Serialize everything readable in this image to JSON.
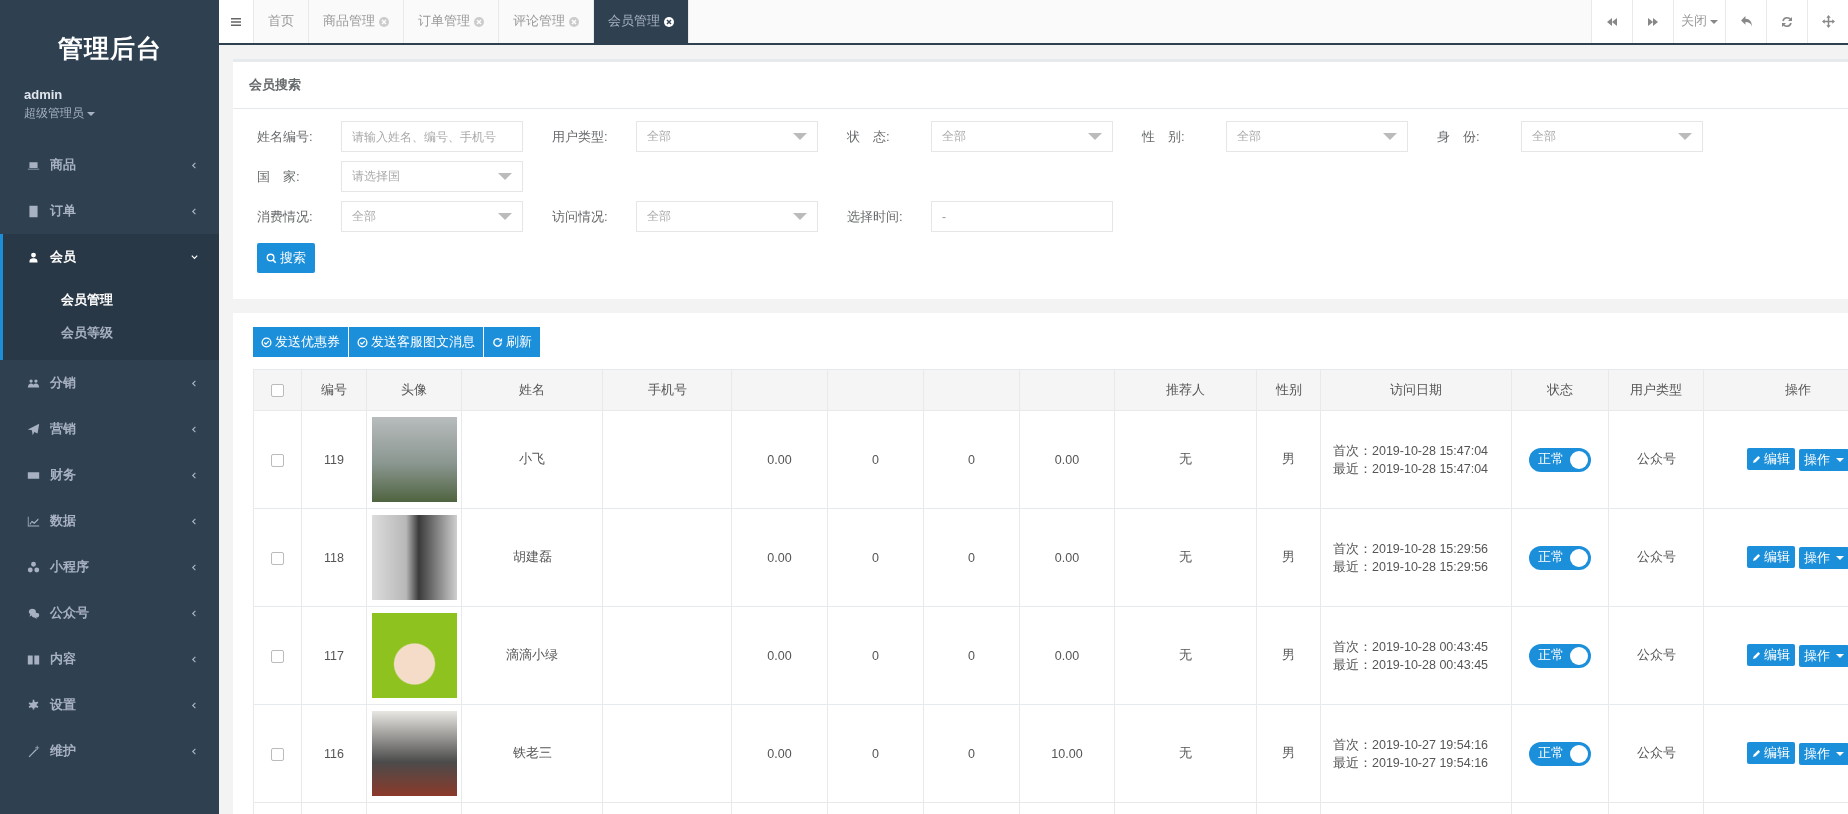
{
  "sidebar": {
    "title": "管理后台",
    "user": {
      "name": "admin",
      "role": "超级管理员"
    },
    "items": [
      {
        "label": "商品",
        "expanded": false,
        "selected": false
      },
      {
        "label": "订单",
        "expanded": false,
        "selected": false
      },
      {
        "label": "会员",
        "expanded": true,
        "selected": true,
        "children": [
          {
            "label": "会员管理",
            "selected": true
          },
          {
            "label": "会员等级",
            "selected": false
          }
        ]
      },
      {
        "label": "分销",
        "expanded": false,
        "selected": false
      },
      {
        "label": "营销",
        "expanded": false,
        "selected": false
      },
      {
        "label": "财务",
        "expanded": false,
        "selected": false
      },
      {
        "label": "数据",
        "expanded": false,
        "selected": false
      },
      {
        "label": "小程序",
        "expanded": false,
        "selected": false
      },
      {
        "label": "公众号",
        "expanded": false,
        "selected": false
      },
      {
        "label": "内容",
        "expanded": false,
        "selected": false
      },
      {
        "label": "设置",
        "expanded": false,
        "selected": false
      },
      {
        "label": "维护",
        "expanded": false,
        "selected": false
      }
    ]
  },
  "tabs": [
    {
      "label": "首页",
      "closable": false,
      "selected": false
    },
    {
      "label": "商品管理",
      "closable": true,
      "selected": false
    },
    {
      "label": "订单管理",
      "closable": true,
      "selected": false
    },
    {
      "label": "评论管理",
      "closable": true,
      "selected": false
    },
    {
      "label": "会员管理",
      "closable": true,
      "selected": true
    }
  ],
  "tab_tools": {
    "close_menu": "关闭"
  },
  "search": {
    "title": "会员搜索",
    "rows": [
      [
        {
          "label": "姓名编号:",
          "kind": "input",
          "placeholder": "请输入姓名、编号、手机号"
        },
        {
          "label": "用户类型:",
          "kind": "select",
          "value": "全部"
        },
        {
          "label": "状　态:",
          "kind": "select",
          "value": "全部"
        },
        {
          "label": "性　别:",
          "kind": "select",
          "value": "全部"
        },
        {
          "label": "身　份:",
          "kind": "select",
          "value": "全部"
        }
      ],
      [
        {
          "label": "国　家:",
          "kind": "select",
          "placeholder": "请选择国"
        }
      ],
      [
        {
          "label": "消费情况:",
          "kind": "select",
          "value": "全部"
        },
        {
          "label": "访问情况:",
          "kind": "select",
          "value": "全部"
        },
        {
          "label": "选择时间:",
          "kind": "input",
          "value": "-"
        }
      ]
    ],
    "button": "搜索"
  },
  "toolbar": [
    "发送优惠券",
    "发送客服图文消息",
    "刷新"
  ],
  "table": {
    "columns": [
      null,
      "编号",
      "头像",
      "姓名",
      "手机号",
      null,
      null,
      null,
      null,
      "推荐人",
      "性别",
      "访问日期",
      "状态",
      "用户类型",
      "操作"
    ],
    "rows": [
      {
        "checked": false,
        "id": "119",
        "name": "小飞",
        "c5": "0.00",
        "c6": "0",
        "c7": "0",
        "c8": "0.00",
        "referrer": "无",
        "gender": "男",
        "first": "首次：2019-10-28 15:47:04",
        "last": "最近：2019-10-28 15:47:04",
        "status": "正常",
        "status_on": true,
        "user_type": "公众号",
        "edit_button": "编辑",
        "action_button": "操作"
      },
      {
        "checked": false,
        "id": "118",
        "name": "胡建磊",
        "c5": "0.00",
        "c6": "0",
        "c7": "0",
        "c8": "0.00",
        "referrer": "无",
        "gender": "男",
        "first": "首次：2019-10-28 15:29:56",
        "last": "最近：2019-10-28 15:29:56",
        "status": "正常",
        "status_on": true,
        "user_type": "公众号",
        "edit_button": "编辑",
        "action_button": "操作"
      },
      {
        "checked": false,
        "id": "117",
        "name": "滴滴小绿",
        "c5": "0.00",
        "c6": "0",
        "c7": "0",
        "c8": "0.00",
        "referrer": "无",
        "gender": "男",
        "first": "首次：2019-10-28 00:43:45",
        "last": "最近：2019-10-28 00:43:45",
        "status": "正常",
        "status_on": true,
        "user_type": "公众号",
        "edit_button": "编辑",
        "action_button": "操作"
      },
      {
        "checked": false,
        "id": "116",
        "name": "铁老三",
        "c5": "0.00",
        "c6": "0",
        "c7": "0",
        "c8": "10.00",
        "referrer": "无",
        "gender": "男",
        "first": "首次：2019-10-27 19:54:16",
        "last": "最近：2019-10-27 19:54:16",
        "status": "正常",
        "status_on": true,
        "user_type": "公众号",
        "edit_button": "编辑",
        "action_button": "操作"
      }
    ],
    "select_all_checked": false
  }
}
